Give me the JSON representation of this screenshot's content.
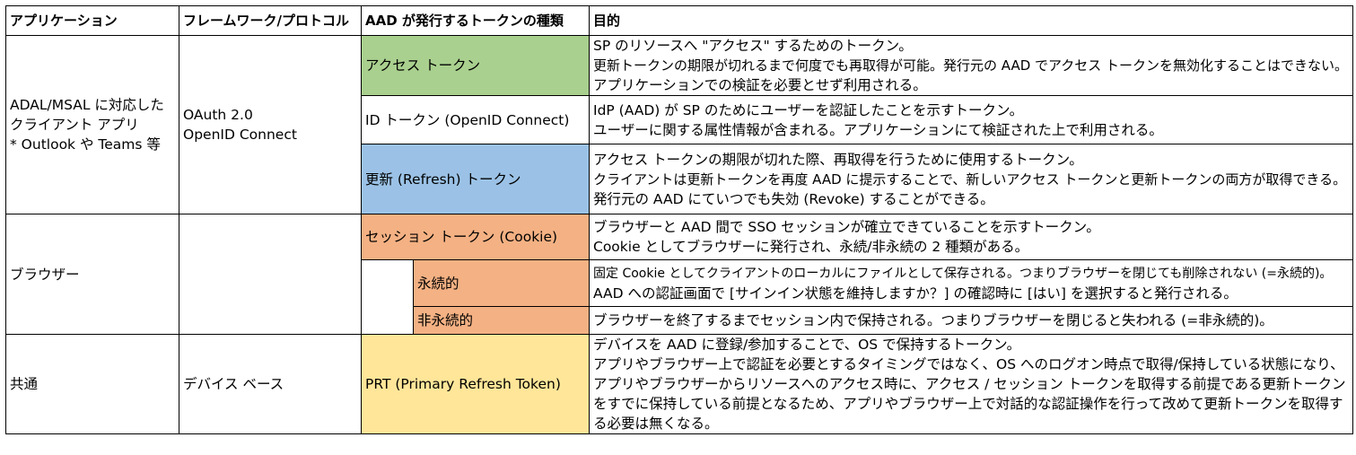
{
  "headers": {
    "app": "アプリケーション",
    "framework": "フレームワーク/プロトコル",
    "token_type": "AAD が発行するトークンの種類",
    "purpose": "目的"
  },
  "groups": {
    "client_app": {
      "app_lines": [
        "ADAL/MSAL に対応した",
        "クライアント アプリ",
        "* Outlook や Teams 等"
      ],
      "framework_lines": [
        "OAuth 2.0",
        "OpenID Connect"
      ]
    },
    "browser": {
      "app": "ブラウザー",
      "framework": ""
    },
    "common": {
      "app": "共通",
      "framework": "デバイス ベース"
    }
  },
  "rows": {
    "access": {
      "token": "アクセス トークン",
      "purpose": [
        "SP のリソースへ \"アクセス\" するためのトークン。",
        "更新トークンの期限が切れるまで何度でも再取得が可能。発行元の AAD でアクセス トークンを無効化することはできない。",
        "アプリケーションでの検証を必要とせず利用される。"
      ]
    },
    "id": {
      "token": "ID トークン (OpenID Connect)",
      "purpose": [
        "IdP (AAD) が SP のためにユーザーを認証したことを示すトークン。",
        "ユーザーに関する属性情報が含まれる。アプリケーションにて検証された上で利用される。"
      ]
    },
    "refresh": {
      "token": "更新 (Refresh) トークン",
      "purpose": [
        "アクセス トークンの期限が切れた際、再取得を行うために使用するトークン。",
        "クライアントは更新トークンを再度 AAD に提示することで、新しいアクセス トークンと更新トークンの両方が取得できる。",
        "発行元の AAD にていつでも失効 (Revoke) することができる。"
      ]
    },
    "session": {
      "token": "セッション トークン (Cookie)",
      "purpose": [
        "ブラウザーと AAD 間で SSO セッションが確立できていることを示すトークン。",
        "Cookie としてブラウザーに発行され、永続/非永続の 2 種類がある。"
      ]
    },
    "persistent": {
      "token": "永続的",
      "purpose": [
        "固定 Cookie としてクライアントのローカルにファイルとして保存される。つまりブラウザーを閉じても削除されない (=永続的)。",
        "AAD への認証画面で [サインイン状態を維持しますか？] の確認時に [はい] を選択すると発行される。"
      ]
    },
    "nonpersistent": {
      "token": "非永続的",
      "purpose": [
        "ブラウザーを終了するまでセッション内で保持される。つまりブラウザーを閉じると失われる (=非永続的)。"
      ]
    },
    "prt": {
      "token": "PRT (Primary Refresh Token)",
      "purpose": [
        "デバイスを AAD に登録/参加することで、OS で保持するトークン。",
        "アプリやブラウザー上で認証を必要とするタイミングではなく、OS へのログオン時点で取得/保持している状態になり、アプリやブラウザーからリソースへのアクセス時に、アクセス / セッション トークンを取得する前提である更新トークンをすでに保持している前提となるため、アプリやブラウザー上で対話的な認証操作を行って改めて更新トークンを取得する必要は無くなる。"
      ]
    }
  },
  "colors": {
    "access": "#a9d08e",
    "id": "#ffffff",
    "refresh": "#9bc2e6",
    "session": "#f4b183",
    "prt": "#ffe699"
  }
}
